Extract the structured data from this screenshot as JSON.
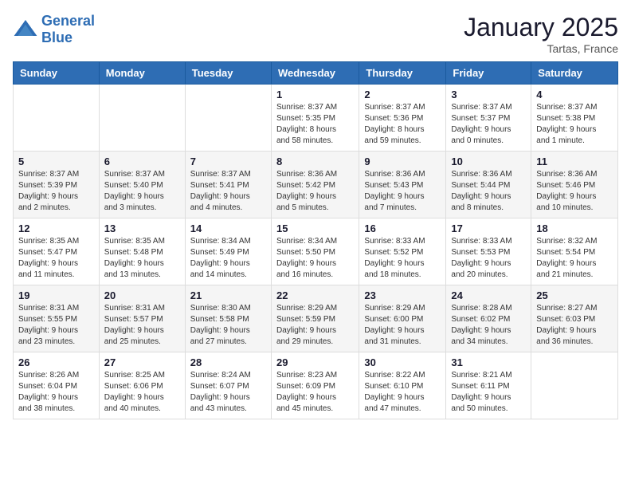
{
  "logo": {
    "text_general": "General",
    "text_blue": "Blue"
  },
  "header": {
    "month_year": "January 2025",
    "location": "Tartas, France"
  },
  "weekdays": [
    "Sunday",
    "Monday",
    "Tuesday",
    "Wednesday",
    "Thursday",
    "Friday",
    "Saturday"
  ],
  "weeks": [
    [
      {
        "day": "",
        "info": ""
      },
      {
        "day": "",
        "info": ""
      },
      {
        "day": "",
        "info": ""
      },
      {
        "day": "1",
        "info": "Sunrise: 8:37 AM\nSunset: 5:35 PM\nDaylight: 8 hours\nand 58 minutes."
      },
      {
        "day": "2",
        "info": "Sunrise: 8:37 AM\nSunset: 5:36 PM\nDaylight: 8 hours\nand 59 minutes."
      },
      {
        "day": "3",
        "info": "Sunrise: 8:37 AM\nSunset: 5:37 PM\nDaylight: 9 hours\nand 0 minutes."
      },
      {
        "day": "4",
        "info": "Sunrise: 8:37 AM\nSunset: 5:38 PM\nDaylight: 9 hours\nand 1 minute."
      }
    ],
    [
      {
        "day": "5",
        "info": "Sunrise: 8:37 AM\nSunset: 5:39 PM\nDaylight: 9 hours\nand 2 minutes."
      },
      {
        "day": "6",
        "info": "Sunrise: 8:37 AM\nSunset: 5:40 PM\nDaylight: 9 hours\nand 3 minutes."
      },
      {
        "day": "7",
        "info": "Sunrise: 8:37 AM\nSunset: 5:41 PM\nDaylight: 9 hours\nand 4 minutes."
      },
      {
        "day": "8",
        "info": "Sunrise: 8:36 AM\nSunset: 5:42 PM\nDaylight: 9 hours\nand 5 minutes."
      },
      {
        "day": "9",
        "info": "Sunrise: 8:36 AM\nSunset: 5:43 PM\nDaylight: 9 hours\nand 7 minutes."
      },
      {
        "day": "10",
        "info": "Sunrise: 8:36 AM\nSunset: 5:44 PM\nDaylight: 9 hours\nand 8 minutes."
      },
      {
        "day": "11",
        "info": "Sunrise: 8:36 AM\nSunset: 5:46 PM\nDaylight: 9 hours\nand 10 minutes."
      }
    ],
    [
      {
        "day": "12",
        "info": "Sunrise: 8:35 AM\nSunset: 5:47 PM\nDaylight: 9 hours\nand 11 minutes."
      },
      {
        "day": "13",
        "info": "Sunrise: 8:35 AM\nSunset: 5:48 PM\nDaylight: 9 hours\nand 13 minutes."
      },
      {
        "day": "14",
        "info": "Sunrise: 8:34 AM\nSunset: 5:49 PM\nDaylight: 9 hours\nand 14 minutes."
      },
      {
        "day": "15",
        "info": "Sunrise: 8:34 AM\nSunset: 5:50 PM\nDaylight: 9 hours\nand 16 minutes."
      },
      {
        "day": "16",
        "info": "Sunrise: 8:33 AM\nSunset: 5:52 PM\nDaylight: 9 hours\nand 18 minutes."
      },
      {
        "day": "17",
        "info": "Sunrise: 8:33 AM\nSunset: 5:53 PM\nDaylight: 9 hours\nand 20 minutes."
      },
      {
        "day": "18",
        "info": "Sunrise: 8:32 AM\nSunset: 5:54 PM\nDaylight: 9 hours\nand 21 minutes."
      }
    ],
    [
      {
        "day": "19",
        "info": "Sunrise: 8:31 AM\nSunset: 5:55 PM\nDaylight: 9 hours\nand 23 minutes."
      },
      {
        "day": "20",
        "info": "Sunrise: 8:31 AM\nSunset: 5:57 PM\nDaylight: 9 hours\nand 25 minutes."
      },
      {
        "day": "21",
        "info": "Sunrise: 8:30 AM\nSunset: 5:58 PM\nDaylight: 9 hours\nand 27 minutes."
      },
      {
        "day": "22",
        "info": "Sunrise: 8:29 AM\nSunset: 5:59 PM\nDaylight: 9 hours\nand 29 minutes."
      },
      {
        "day": "23",
        "info": "Sunrise: 8:29 AM\nSunset: 6:00 PM\nDaylight: 9 hours\nand 31 minutes."
      },
      {
        "day": "24",
        "info": "Sunrise: 8:28 AM\nSunset: 6:02 PM\nDaylight: 9 hours\nand 34 minutes."
      },
      {
        "day": "25",
        "info": "Sunrise: 8:27 AM\nSunset: 6:03 PM\nDaylight: 9 hours\nand 36 minutes."
      }
    ],
    [
      {
        "day": "26",
        "info": "Sunrise: 8:26 AM\nSunset: 6:04 PM\nDaylight: 9 hours\nand 38 minutes."
      },
      {
        "day": "27",
        "info": "Sunrise: 8:25 AM\nSunset: 6:06 PM\nDaylight: 9 hours\nand 40 minutes."
      },
      {
        "day": "28",
        "info": "Sunrise: 8:24 AM\nSunset: 6:07 PM\nDaylight: 9 hours\nand 43 minutes."
      },
      {
        "day": "29",
        "info": "Sunrise: 8:23 AM\nSunset: 6:09 PM\nDaylight: 9 hours\nand 45 minutes."
      },
      {
        "day": "30",
        "info": "Sunrise: 8:22 AM\nSunset: 6:10 PM\nDaylight: 9 hours\nand 47 minutes."
      },
      {
        "day": "31",
        "info": "Sunrise: 8:21 AM\nSunset: 6:11 PM\nDaylight: 9 hours\nand 50 minutes."
      },
      {
        "day": "",
        "info": ""
      }
    ]
  ]
}
